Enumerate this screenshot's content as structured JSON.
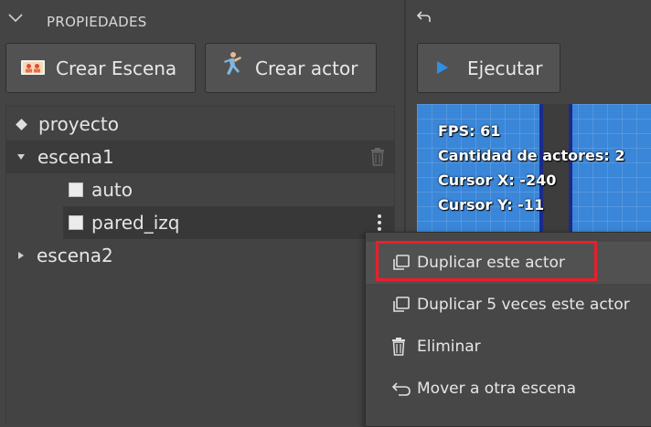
{
  "panel": {
    "title": "PROPIEDADES"
  },
  "toolbar": {
    "create_scene_label": "Crear Escena",
    "create_actor_label": "Crear actor",
    "run_label": "Ejecutar"
  },
  "tree": {
    "project": "proyecto",
    "scenes": [
      {
        "name": "escena1",
        "expanded": true,
        "actors": [
          "auto",
          "pared_izq"
        ]
      },
      {
        "name": "escena2",
        "expanded": false,
        "actors": []
      }
    ]
  },
  "hud": {
    "fps": "FPS: 61",
    "actors": "Cantidad de actores: 2",
    "cursor_x": "Cursor X: -240",
    "cursor_y": "Cursor Y: -11"
  },
  "context_menu": {
    "items": [
      {
        "label": "Duplicar este actor",
        "icon": "copy-icon"
      },
      {
        "label": "Duplicar 5 veces este actor",
        "icon": "copy-icon"
      },
      {
        "label": "Eliminar",
        "icon": "trash-icon"
      },
      {
        "label": "Mover a otra escena",
        "icon": "undo-arrow-icon"
      }
    ]
  },
  "colors": {
    "background": "#444444",
    "viewport": "#3a86d8",
    "highlight_border": "#e8202a",
    "run_icon": "#2f8fe8"
  }
}
